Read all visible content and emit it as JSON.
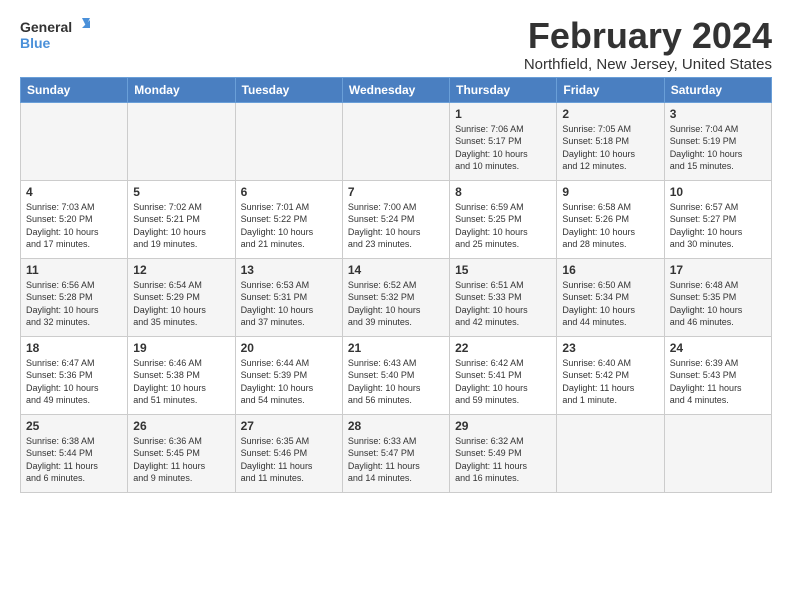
{
  "logo": {
    "general": "General",
    "blue": "Blue"
  },
  "header": {
    "month": "February 2024",
    "location": "Northfield, New Jersey, United States"
  },
  "weekdays": [
    "Sunday",
    "Monday",
    "Tuesday",
    "Wednesday",
    "Thursday",
    "Friday",
    "Saturday"
  ],
  "weeks": [
    [
      {
        "day": "",
        "info": ""
      },
      {
        "day": "",
        "info": ""
      },
      {
        "day": "",
        "info": ""
      },
      {
        "day": "",
        "info": ""
      },
      {
        "day": "1",
        "info": "Sunrise: 7:06 AM\nSunset: 5:17 PM\nDaylight: 10 hours\nand 10 minutes."
      },
      {
        "day": "2",
        "info": "Sunrise: 7:05 AM\nSunset: 5:18 PM\nDaylight: 10 hours\nand 12 minutes."
      },
      {
        "day": "3",
        "info": "Sunrise: 7:04 AM\nSunset: 5:19 PM\nDaylight: 10 hours\nand 15 minutes."
      }
    ],
    [
      {
        "day": "4",
        "info": "Sunrise: 7:03 AM\nSunset: 5:20 PM\nDaylight: 10 hours\nand 17 minutes."
      },
      {
        "day": "5",
        "info": "Sunrise: 7:02 AM\nSunset: 5:21 PM\nDaylight: 10 hours\nand 19 minutes."
      },
      {
        "day": "6",
        "info": "Sunrise: 7:01 AM\nSunset: 5:22 PM\nDaylight: 10 hours\nand 21 minutes."
      },
      {
        "day": "7",
        "info": "Sunrise: 7:00 AM\nSunset: 5:24 PM\nDaylight: 10 hours\nand 23 minutes."
      },
      {
        "day": "8",
        "info": "Sunrise: 6:59 AM\nSunset: 5:25 PM\nDaylight: 10 hours\nand 25 minutes."
      },
      {
        "day": "9",
        "info": "Sunrise: 6:58 AM\nSunset: 5:26 PM\nDaylight: 10 hours\nand 28 minutes."
      },
      {
        "day": "10",
        "info": "Sunrise: 6:57 AM\nSunset: 5:27 PM\nDaylight: 10 hours\nand 30 minutes."
      }
    ],
    [
      {
        "day": "11",
        "info": "Sunrise: 6:56 AM\nSunset: 5:28 PM\nDaylight: 10 hours\nand 32 minutes."
      },
      {
        "day": "12",
        "info": "Sunrise: 6:54 AM\nSunset: 5:29 PM\nDaylight: 10 hours\nand 35 minutes."
      },
      {
        "day": "13",
        "info": "Sunrise: 6:53 AM\nSunset: 5:31 PM\nDaylight: 10 hours\nand 37 minutes."
      },
      {
        "day": "14",
        "info": "Sunrise: 6:52 AM\nSunset: 5:32 PM\nDaylight: 10 hours\nand 39 minutes."
      },
      {
        "day": "15",
        "info": "Sunrise: 6:51 AM\nSunset: 5:33 PM\nDaylight: 10 hours\nand 42 minutes."
      },
      {
        "day": "16",
        "info": "Sunrise: 6:50 AM\nSunset: 5:34 PM\nDaylight: 10 hours\nand 44 minutes."
      },
      {
        "day": "17",
        "info": "Sunrise: 6:48 AM\nSunset: 5:35 PM\nDaylight: 10 hours\nand 46 minutes."
      }
    ],
    [
      {
        "day": "18",
        "info": "Sunrise: 6:47 AM\nSunset: 5:36 PM\nDaylight: 10 hours\nand 49 minutes."
      },
      {
        "day": "19",
        "info": "Sunrise: 6:46 AM\nSunset: 5:38 PM\nDaylight: 10 hours\nand 51 minutes."
      },
      {
        "day": "20",
        "info": "Sunrise: 6:44 AM\nSunset: 5:39 PM\nDaylight: 10 hours\nand 54 minutes."
      },
      {
        "day": "21",
        "info": "Sunrise: 6:43 AM\nSunset: 5:40 PM\nDaylight: 10 hours\nand 56 minutes."
      },
      {
        "day": "22",
        "info": "Sunrise: 6:42 AM\nSunset: 5:41 PM\nDaylight: 10 hours\nand 59 minutes."
      },
      {
        "day": "23",
        "info": "Sunrise: 6:40 AM\nSunset: 5:42 PM\nDaylight: 11 hours\nand 1 minute."
      },
      {
        "day": "24",
        "info": "Sunrise: 6:39 AM\nSunset: 5:43 PM\nDaylight: 11 hours\nand 4 minutes."
      }
    ],
    [
      {
        "day": "25",
        "info": "Sunrise: 6:38 AM\nSunset: 5:44 PM\nDaylight: 11 hours\nand 6 minutes."
      },
      {
        "day": "26",
        "info": "Sunrise: 6:36 AM\nSunset: 5:45 PM\nDaylight: 11 hours\nand 9 minutes."
      },
      {
        "day": "27",
        "info": "Sunrise: 6:35 AM\nSunset: 5:46 PM\nDaylight: 11 hours\nand 11 minutes."
      },
      {
        "day": "28",
        "info": "Sunrise: 6:33 AM\nSunset: 5:47 PM\nDaylight: 11 hours\nand 14 minutes."
      },
      {
        "day": "29",
        "info": "Sunrise: 6:32 AM\nSunset: 5:49 PM\nDaylight: 11 hours\nand 16 minutes."
      },
      {
        "day": "",
        "info": ""
      },
      {
        "day": "",
        "info": ""
      }
    ]
  ]
}
